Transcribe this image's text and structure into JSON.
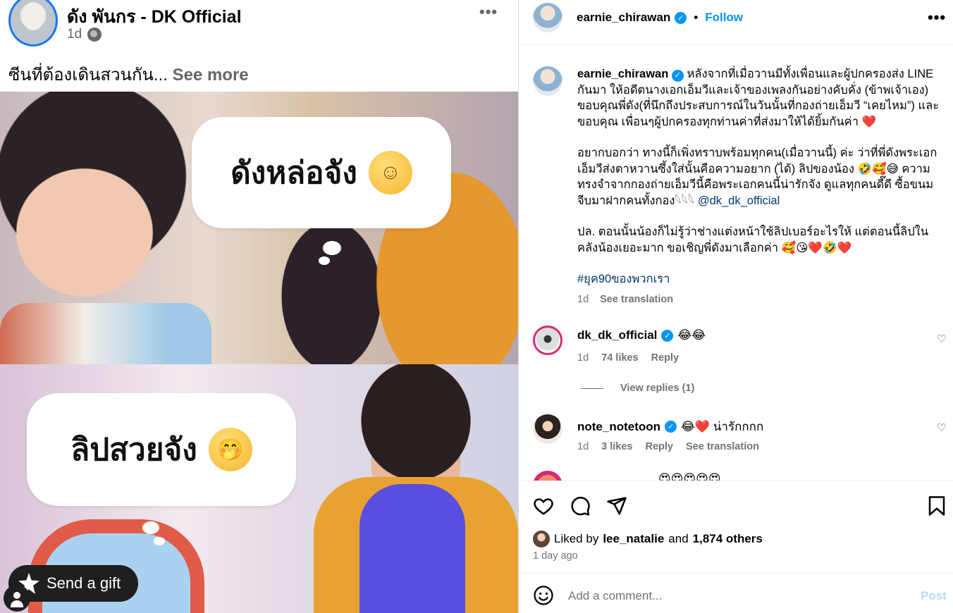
{
  "facebook": {
    "author": "ดัง พันกร - DK Official",
    "time": "1d",
    "caption": "ซีนที่ต้องเดินสวนกัน...",
    "see_more": "See more",
    "more_glyph": "•••",
    "meme_bubble_1": "ดังหล่อจัง",
    "meme_bubble_1_emoji": "☺",
    "meme_bubble_2": "ลิปสวยจัง",
    "meme_bubble_2_emoji": "🤭",
    "gift_label": "Send a gift"
  },
  "instagram": {
    "post_author": "earnie_chirawan",
    "follow_label": "Follow",
    "bullet": "•",
    "more_glyph": "•••",
    "caption": {
      "username": "earnie_chirawan",
      "para1": "หลังจากที่เมื่อวานมีทั้งเพื่อนและผู้ปกครองส่ง LINE กันมา ให้อดีตนางเอกเอ็มวีและเจ้าของเพลงกันอย่างคับคั่ง (ข้าพเจ้าเอง) ขอบคุณพี่ดัง(ที่นึกถึงประสบการณ์ในวันนั้นที่กองถ่ายเอ็มวี “เคยไหม”) และ ขอบคุณ เพื่อนๆผู้ปกครองทุกท่านค่าที่ส่งมาให้ได้ยิ้มกันค่า",
      "para1_emoji": "❤️",
      "para2": "อยากบอกว่า ทางนี้ก็เพิ่งทราบพร้อมทุกคน(เมื่อวานนี้) ค่ะ ว่าที่พี่ดังพระเอกเอ็มวีส่งตาหวานซึ้งใส่นั้นคือความอยาก (ได้) ลิปของน้อง 🤣🥰😅 ความทรงจำจากกองถ่ายเอ็มวีนี้คือพระเอกคนนี้น่ารักจัง ดูแลทุกคนดี๊ดี ซื้อขนมจีบมาฝากคนทั้งกอง𓆩𓆩𓆩",
      "mention": "@dk_dk_official",
      "para3": "ปล. ตอนนั้นน้องก็ไม่รู้ว่าช่างแต่งหน้าใช้ลิปเบอร์อะไรให้ แต่ตอนนี้ลิปในคลังน้องเยอะมาก ขอเชิญพี่ดังมาเลือกค่า 🥰😘❤️🤣❤️",
      "hashtag": "#ยุค90ของพวกเรา",
      "time": "1d",
      "see_translation": "See translation"
    },
    "comments": [
      {
        "username": "dk_dk_official",
        "text": "😂😂",
        "time": "1d",
        "likes": "74 likes",
        "reply": "Reply",
        "view_replies": "View replies (1)"
      },
      {
        "username": "note_notetoon",
        "text": "😂❤️ น่ารักกกก",
        "time": "1d",
        "likes": "3 likes",
        "reply": "Reply",
        "see_translation": "See translation"
      }
    ],
    "partial_comment": "😍😍😍😍😍",
    "liked_by_prefix": "Liked by",
    "liked_by_user": "lee_natalie",
    "liked_by_and": "and",
    "liked_by_others": "1,874 others",
    "post_date": "1 day ago",
    "add_comment_placeholder": "Add a comment...",
    "post_button": "Post",
    "colors": {
      "accent": "#0095f6",
      "muted": "#737373",
      "heart": "#e0245e"
    }
  }
}
